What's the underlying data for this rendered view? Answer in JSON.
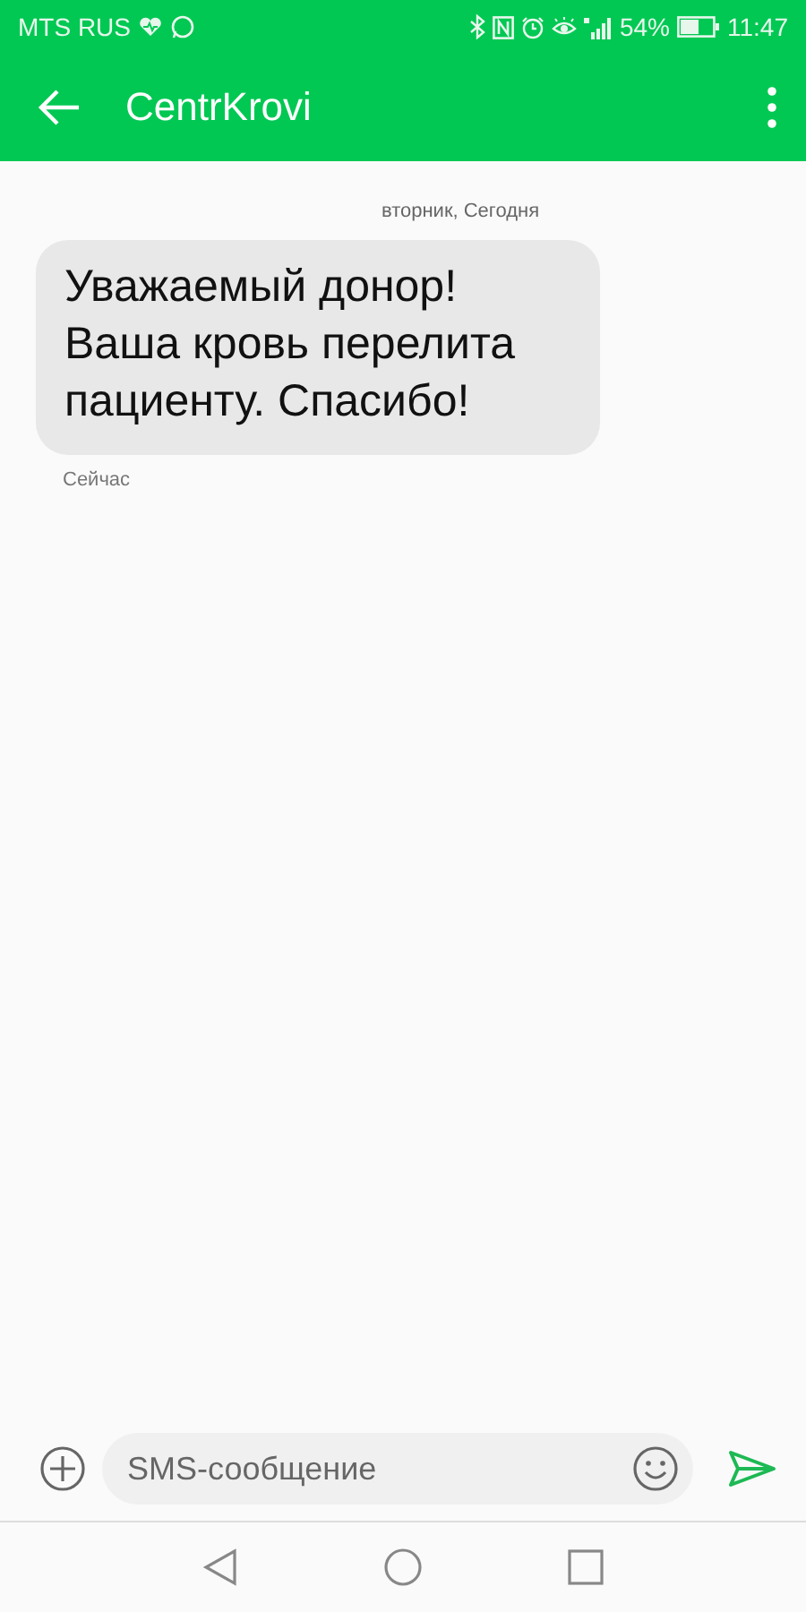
{
  "status_bar": {
    "carrier": "MTS RUS",
    "battery": "54%",
    "time": "11:47"
  },
  "app_bar": {
    "title": "CentrKrovi"
  },
  "conversation": {
    "date": "вторник, Сегодня",
    "messages": [
      {
        "text": "Уважаемый донор! Ваша кровь перелита пациенту. Спасибо!",
        "time": "Сейчас"
      }
    ]
  },
  "composer": {
    "placeholder": "SMS-сообщение"
  }
}
